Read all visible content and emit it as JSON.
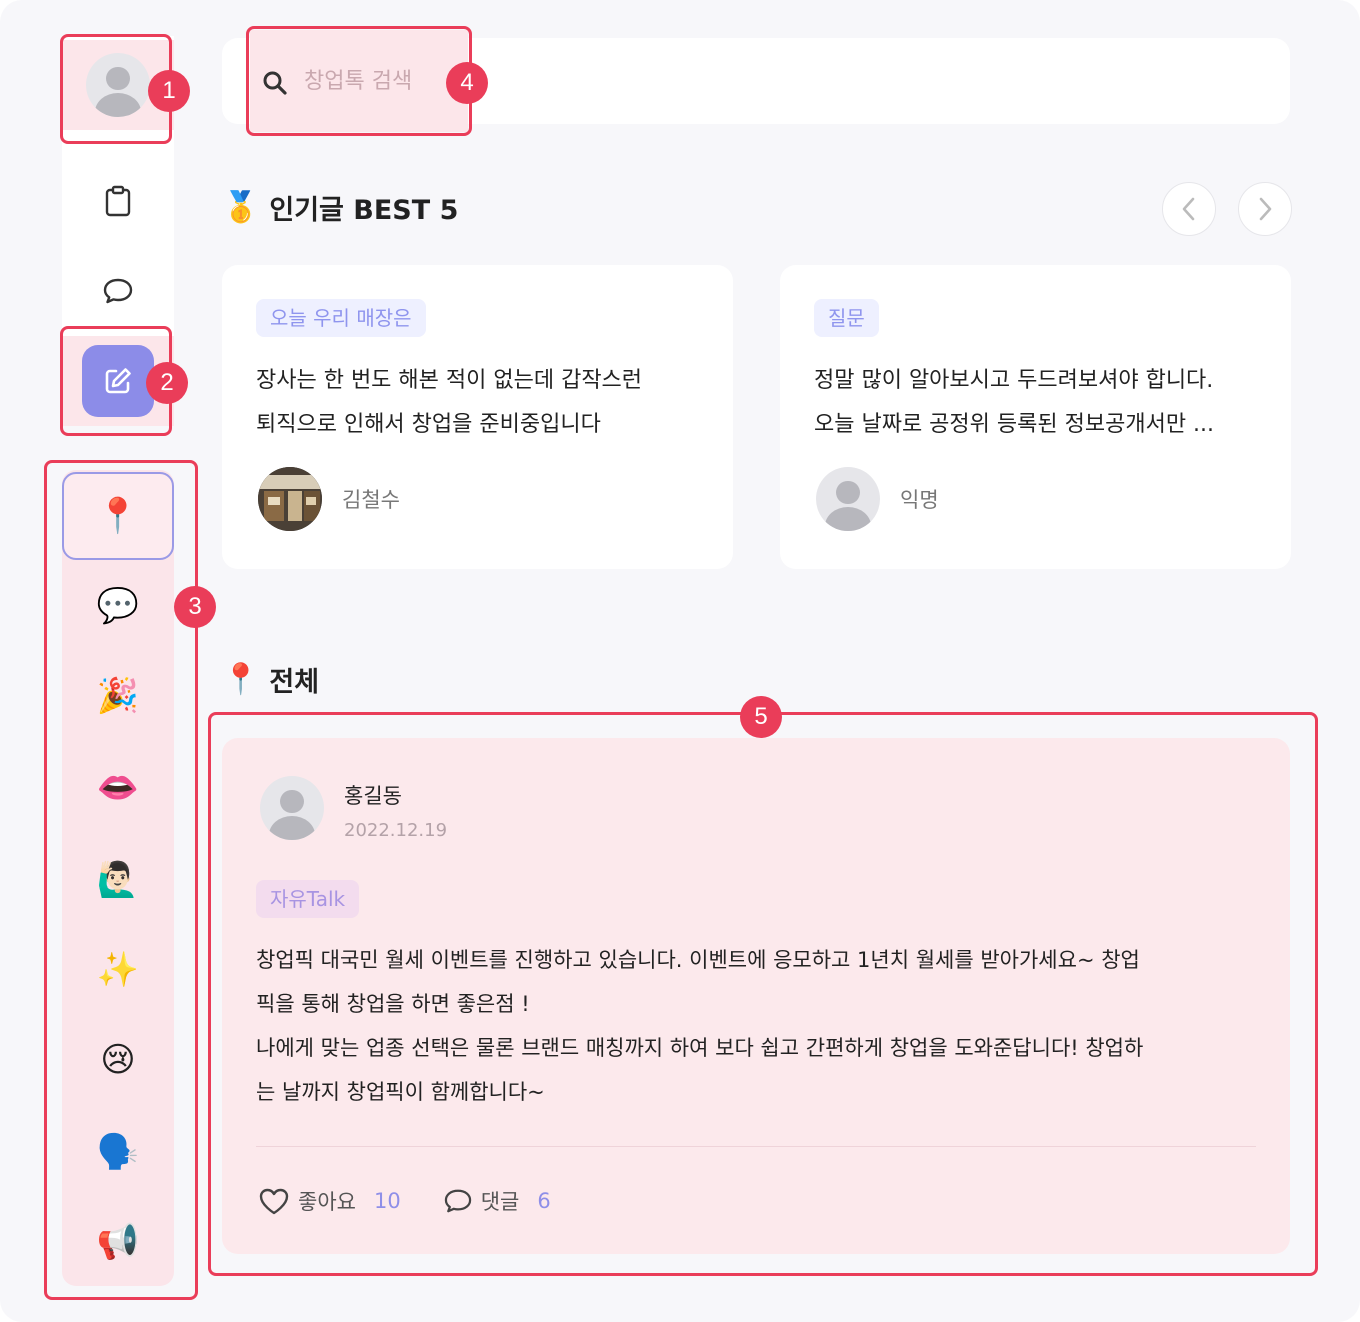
{
  "search": {
    "placeholder": "창업톡 검색"
  },
  "rail": {
    "items": [
      {
        "name": "profile",
        "icon": "avatar-icon"
      },
      {
        "name": "board",
        "icon": "clipboard-icon"
      },
      {
        "name": "chat",
        "icon": "speech-bubble-icon"
      },
      {
        "name": "write",
        "icon": "pencil-square-icon"
      }
    ]
  },
  "categories": [
    {
      "emoji": "📍",
      "name": "all"
    },
    {
      "emoji": "💬",
      "name": "free-talk"
    },
    {
      "emoji": "🎉",
      "name": "celebrate"
    },
    {
      "emoji": "👄",
      "name": "lips"
    },
    {
      "emoji": "🙋🏻‍♂️",
      "name": "question"
    },
    {
      "emoji": "✨",
      "name": "sparkles"
    },
    {
      "emoji": "😢",
      "name": "sad"
    },
    {
      "emoji": "🗣️",
      "name": "speaking"
    },
    {
      "emoji": "📢",
      "name": "announcement"
    }
  ],
  "best": {
    "emoji": "🥇",
    "title": "인기글 BEST 5",
    "cards": [
      {
        "tag": "오늘 우리 매장은",
        "lines": [
          "장사는 한 번도 해본 적이 없는데 갑작스런",
          "퇴직으로 인해서 창업을 준비중입니다"
        ],
        "author": "김철수"
      },
      {
        "tag": "질문",
        "lines": [
          "정말 많이 알아보시고 두드려보셔야 합니다.",
          "오늘 날짜로 공정위 등록된 정보공개서만 ..."
        ],
        "author": "익명"
      }
    ]
  },
  "all": {
    "emoji": "📍",
    "title": "전체"
  },
  "post": {
    "author": "홍길동",
    "date": "2022.12.19",
    "tag": "자유Talk",
    "lines": [
      "창업픽 대국민 월세 이벤트를 진행하고 있습니다.  이벤트에 응모하고 1년치 월세를 받아가세요~ 창업",
      "픽을 통해 창업을 하면 좋은점 !",
      "나에게 맞는 업종 선택은 물론 브랜드 매칭까지 하여 보다 쉽고 간편하게 창업을 도와준답니다! 창업하",
      "는 날까지 창업픽이 함께합니다~"
    ],
    "like_label": "좋아요",
    "like_count": "10",
    "comment_label": "댓글",
    "comment_count": "6"
  },
  "annotations": [
    "1",
    "2",
    "3",
    "4",
    "5"
  ],
  "colors": {
    "accent": "#8c8ce8",
    "highlight": "#ea3d59",
    "post_bg": "#fce9ec",
    "category_bg": "#fbe5ea"
  }
}
